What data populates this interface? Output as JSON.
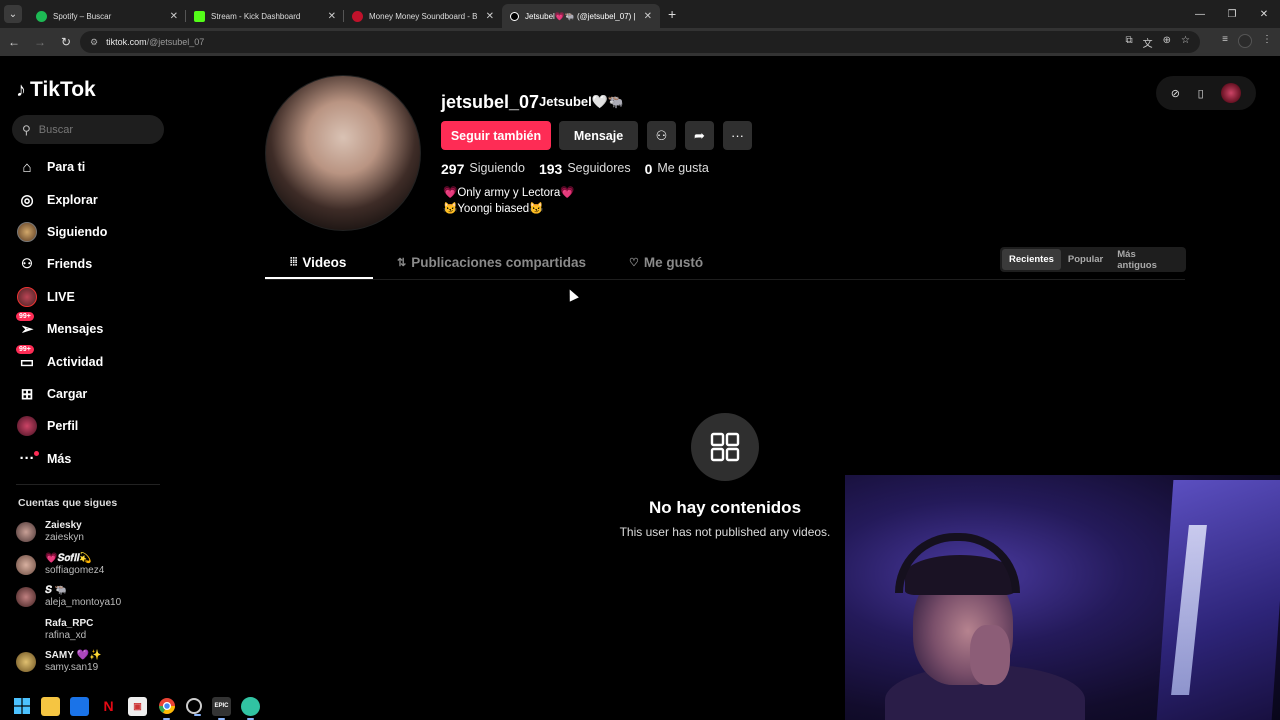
{
  "browser": {
    "tabs": [
      {
        "title": "Spotify – Buscar",
        "favicon_color": "#1db954",
        "active": false
      },
      {
        "title": "Stream - Kick Dashboard",
        "favicon_color": "#53fc18",
        "active": false
      },
      {
        "title": "Money Money Soundboard - B",
        "favicon_color": "#c0122b",
        "active": false
      },
      {
        "title": "Jetsubel💗🐃 (@jetsubel_07) |",
        "favicon_color": "#ffffff",
        "active": true
      }
    ],
    "url_host": "tiktok.com",
    "url_path": "/@jetsubel_07"
  },
  "sidebar": {
    "logo": "TikTok",
    "search_placeholder": "Buscar",
    "nav": [
      {
        "label": "Para ti",
        "icon": "home-icon",
        "glyph": "⌂"
      },
      {
        "label": "Explorar",
        "icon": "compass-icon",
        "glyph": "◎"
      },
      {
        "label": "Siguiendo",
        "icon": "following-avatar-icon",
        "glyph": ""
      },
      {
        "label": "Friends",
        "icon": "friends-icon",
        "glyph": "👥"
      },
      {
        "label": "LIVE",
        "icon": "live-icon",
        "glyph": ""
      },
      {
        "label": "Mensajes",
        "icon": "messages-icon",
        "glyph": "✈",
        "badge": "99+"
      },
      {
        "label": "Actividad",
        "icon": "activity-icon",
        "glyph": "▭",
        "badge": "99+"
      },
      {
        "label": "Cargar",
        "icon": "upload-icon",
        "glyph": "⊞"
      },
      {
        "label": "Perfil",
        "icon": "profile-avatar-icon",
        "glyph": ""
      },
      {
        "label": "Más",
        "icon": "more-icon",
        "glyph": "···"
      }
    ],
    "following_title": "Cuentas que sigues",
    "following": [
      {
        "name": "Zaiesky",
        "handle": "zaieskyn",
        "color": "#8a6a6a"
      },
      {
        "name": "💗𝑺𝒐𝒇𝒊𝒊💫",
        "handle": "soffiagomez4",
        "color": "#b08070"
      },
      {
        "name": "𝑺 🐃",
        "handle": "aleja_montoya10",
        "color": "#7a5050"
      },
      {
        "name": "Rafa_RPC",
        "handle": "rafina_xd",
        "color": "#000000"
      },
      {
        "name": "SAMY 💜✨",
        "handle": "samy.san19",
        "color": "#c0a040"
      }
    ]
  },
  "profile": {
    "username": "jetsubel_07",
    "nickname": "Jetsubel🤍🐃",
    "follow_button": "Seguir también",
    "message_button": "Mensaje",
    "stats": [
      {
        "number": "297",
        "label": "Siguiendo"
      },
      {
        "number": "193",
        "label": "Seguidores"
      },
      {
        "number": "0",
        "label": "Me gusta"
      }
    ],
    "bio_lines": [
      "💗Only army y Lectora💗",
      "😼Yoongi biased😼"
    ],
    "tabs": [
      {
        "label": "Videos",
        "icon": "grid-icon"
      },
      {
        "label": "Publicaciones compartidas",
        "icon": "repost-icon"
      },
      {
        "label": "Me gustó",
        "icon": "heart-icon"
      }
    ],
    "sort_options": [
      "Recientes",
      "Popular",
      "Más antiguos"
    ],
    "sort_selected": "Recientes",
    "empty_title": "No hay contenidos",
    "empty_subtitle": "This user has not published any videos."
  },
  "taskbar": {
    "apps": [
      "windows-start-icon",
      "file-explorer-icon",
      "calendar-icon",
      "netflix-icon",
      "paint-icon",
      "chrome-icon",
      "obs-icon",
      "epic-games-icon",
      "streamlabs-icon"
    ]
  },
  "colors": {
    "accent": "#fe2c55",
    "background": "#000000",
    "button_dark": "#2f2f2f"
  }
}
